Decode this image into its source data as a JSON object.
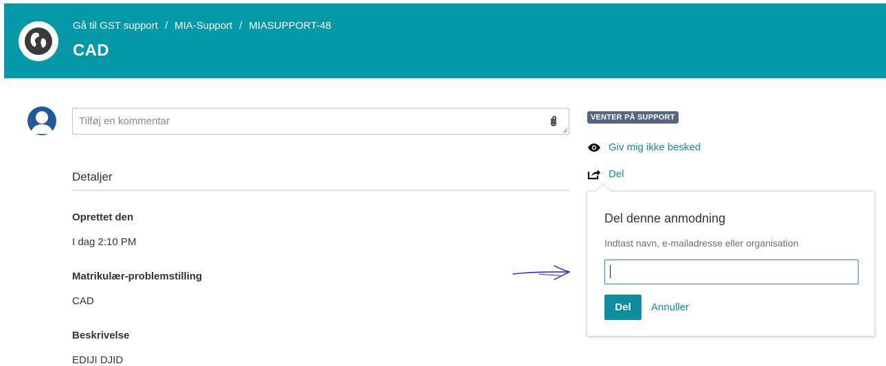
{
  "header": {
    "breadcrumbs": [
      "Gå til GST support",
      "MIA-Support",
      "MIASUPPORT-48"
    ],
    "separator": "/",
    "title": "CAD",
    "background_color": "#0499a8"
  },
  "comment": {
    "placeholder": "Tilføj en kommentar",
    "value": ""
  },
  "details": {
    "heading": "Detaljer",
    "fields": [
      {
        "label": "Oprettet den",
        "value": "I dag 2:10 PM"
      },
      {
        "label": "Matrikulær-problemstilling",
        "value": "CAD"
      },
      {
        "label": "Beskrivelse",
        "value": "EDIJI DJID"
      }
    ]
  },
  "sidebar": {
    "status": "VENTER PÅ SUPPORT",
    "status_color": "#53687e",
    "watch_label": "Giv mig ikke besked",
    "share_label": "Del",
    "link_color": "#0e8e9d"
  },
  "share_popup": {
    "title": "Del denne anmodning",
    "hint": "Indtast navn, e-mailadresse eller organisation",
    "input_value": "",
    "share_button": "Del",
    "cancel_link": "Annuller"
  },
  "icons": [
    "globe-icon",
    "user-avatar-icon",
    "paperclip-icon",
    "eye-icon",
    "share-icon",
    "hand-drawn-arrow"
  ]
}
